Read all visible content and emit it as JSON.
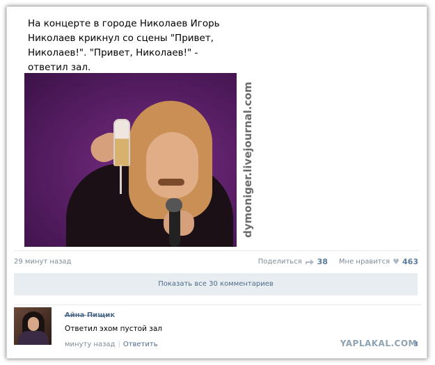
{
  "post": {
    "text": "На концерте в городе Николаев Игорь Николаев крикнул со сцены \"Привет, Николаев!\". \"Привет, Николаев!\" - ответил зал.",
    "watermark": "dymoniger.livejournal.com",
    "time": "29 минут назад",
    "share_label": "Поделиться",
    "share_count": "38",
    "like_label": "Мне нравится",
    "like_count": "463",
    "show_comments_label": "Показать все 30 комментариев"
  },
  "comment": {
    "author": "А̶й̶н̶а̶ ̶П̶и̶щ̶и̶к",
    "text": "Ответил эхом пустой зал",
    "time": "минуту назад",
    "reply_label": "Ответить",
    "like_count": "3"
  },
  "site_mark": "YAPLAKAL.COM",
  "icons": [
    "share-icon",
    "heart-icon"
  ],
  "colors": {
    "link": "#4d6a8a",
    "meta": "#7f8a96",
    "button_bg": "#e8edf2"
  }
}
